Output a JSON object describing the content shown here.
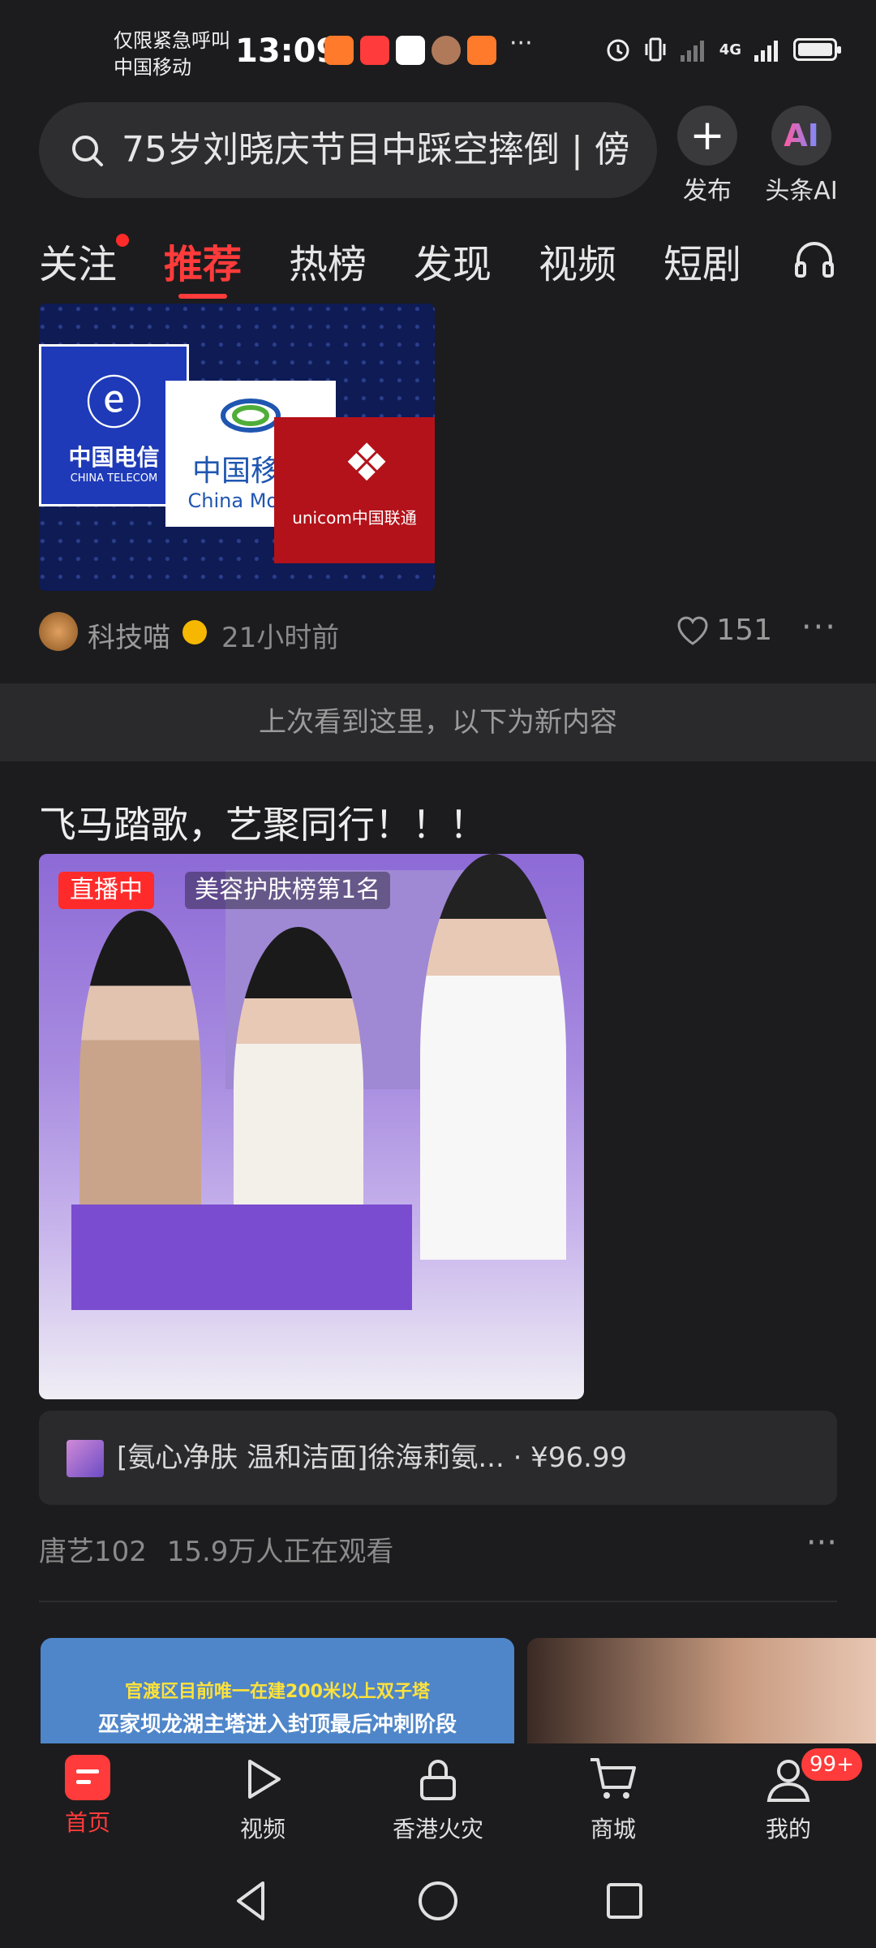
{
  "status_bar": {
    "carrier_line1": "仅限紧急呼叫",
    "carrier_line2": "中国移动",
    "time": "13:09",
    "more": "···",
    "network_label": "4G"
  },
  "search": {
    "query": "75岁刘晓庆节目中踩空摔倒 | 傍",
    "publish_label": "发布",
    "ai_label": "头条AI",
    "ai_icon_text": "AI"
  },
  "tabs": [
    {
      "label": "关注"
    },
    {
      "label": "推荐"
    },
    {
      "label": "热榜"
    },
    {
      "label": "发现"
    },
    {
      "label": "视频"
    },
    {
      "label": "短剧"
    }
  ],
  "post1": {
    "image_texts": {
      "telecom_cn": "中国电信",
      "telecom_en": "CHINA TELECOM",
      "mobile_cn": "中国移动",
      "mobile_en": "China Mobile",
      "unicom": "unicom中国联通"
    },
    "author": "科技喵",
    "time": "21小时前",
    "likes": "151"
  },
  "divider_text": "上次看到这里，以下为新内容",
  "post2": {
    "title": "飞马踏歌，艺聚同行！！！",
    "live_label": "直播中",
    "rank_label": "美容护肤榜第1名",
    "product_text": "[氨心净肤 温和洁面]徐海莉氨... · ¥96.99",
    "author": "唐艺102",
    "viewers": "15.9万人正在观看"
  },
  "preview": {
    "line1": "官渡区目前唯一在建200米以上双子塔",
    "line2": "巫家坝龙湖主塔进入封顶最后冲刺阶段"
  },
  "bottom_nav": [
    {
      "label": "首页"
    },
    {
      "label": "视频"
    },
    {
      "label": "香港火灾"
    },
    {
      "label": "商城"
    },
    {
      "label": "我的"
    }
  ],
  "badge": "99+",
  "colors": {
    "accent": "#ff3b3b",
    "background": "#1c1c1e",
    "card": "#2a2a2c"
  }
}
